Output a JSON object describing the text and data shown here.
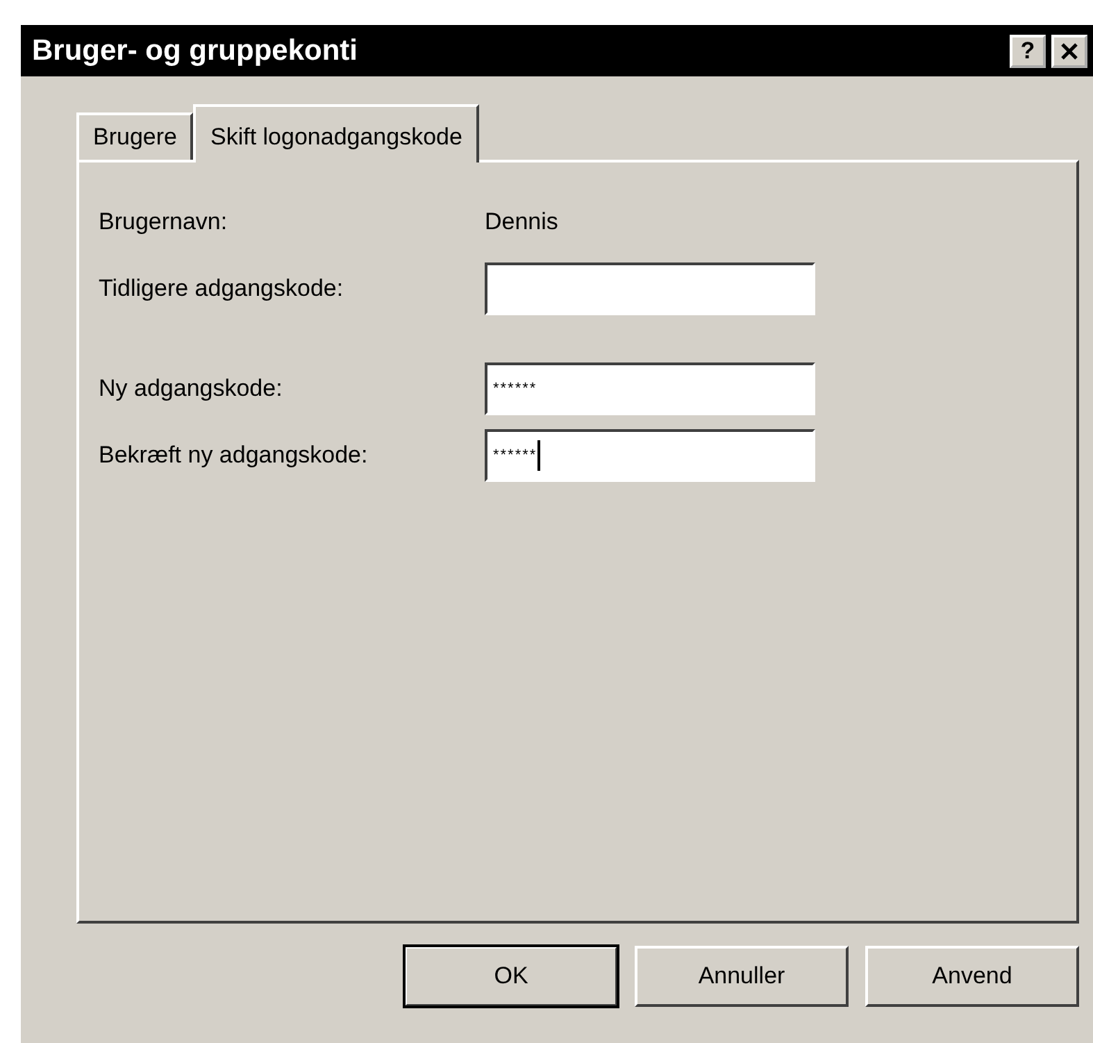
{
  "window": {
    "title": "Bruger- og gruppekonti",
    "help_button": "?"
  },
  "tabs": [
    {
      "label": "Brugere",
      "selected": false
    },
    {
      "label": "Skift logonadgangskode",
      "selected": true
    }
  ],
  "groups": [
    [
      {
        "kind": "text",
        "label": "Brugernavn:",
        "value": "Dennis"
      },
      {
        "kind": "input",
        "label": "Tidligere adgangskode:",
        "focused": false
      }
    ],
    [
      {
        "kind": "input",
        "label": "Ny adgangskode:",
        "value": "******",
        "focused": false
      },
      {
        "kind": "input",
        "label": "Bekræft ny adgangskode:",
        "value": "******",
        "focused": true
      }
    ]
  ],
  "buttons": [
    {
      "label": "OK",
      "default": true
    },
    {
      "label": "Annuller",
      "default": false
    },
    {
      "label": "Anvend",
      "default": false
    }
  ]
}
